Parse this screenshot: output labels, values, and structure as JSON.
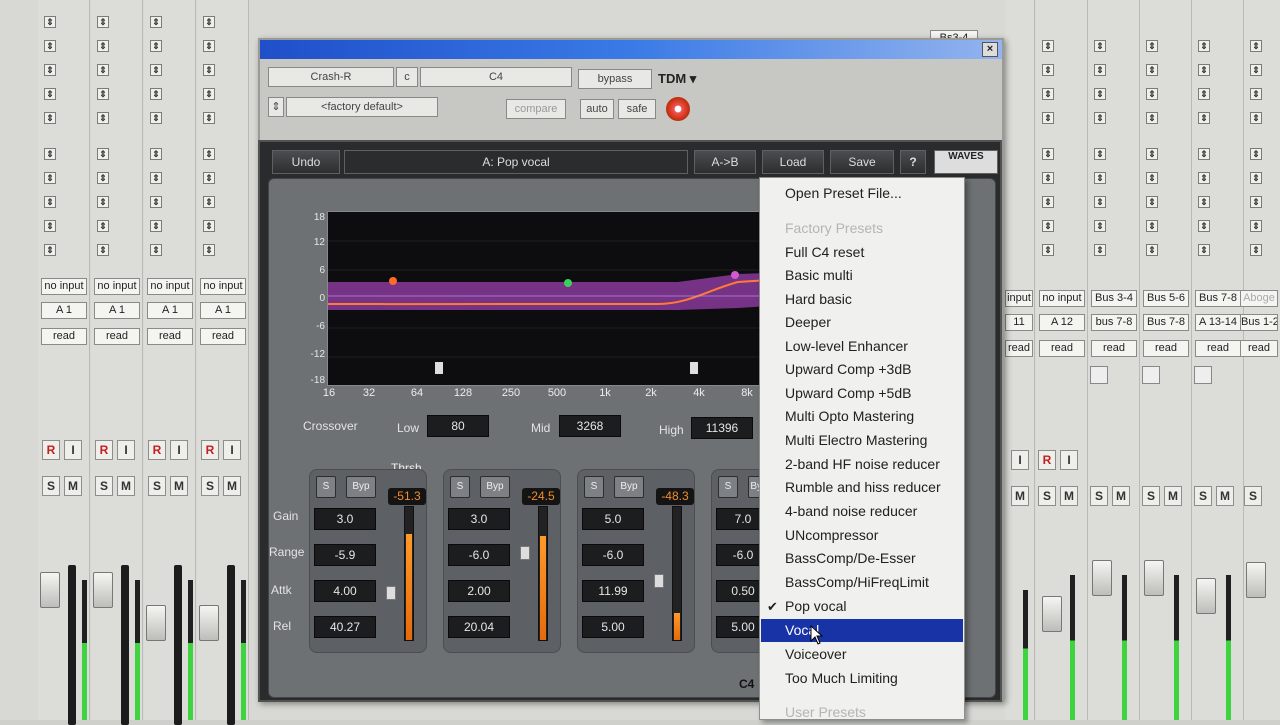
{
  "mixer": {
    "left_strips": [
      {
        "io": "no input",
        "out": "A 1",
        "mode": "read"
      },
      {
        "io": "no input",
        "out": "A 1",
        "mode": "read"
      },
      {
        "io": "no input",
        "out": "A 1",
        "mode": "read"
      },
      {
        "io": "no input",
        "out": "A 1",
        "mode": "read"
      }
    ],
    "right_strips": [
      {
        "io": "input",
        "out": "11",
        "mode": "read"
      },
      {
        "io": "no input",
        "out": "A 12",
        "mode": "read"
      },
      {
        "io": "Bus 3-4",
        "out": "bus 7-8",
        "mode": "read"
      },
      {
        "io": "Bus 5-6",
        "out": "Bus 7-8",
        "mode": "read"
      },
      {
        "io": "Bus 7-8",
        "out": "A 13-14",
        "mode": "read"
      },
      {
        "io": "Aboge",
        "out": "Bus 1-2",
        "mode": "read"
      }
    ],
    "top_insert_label": "Bs3-4",
    "rec_label": "R",
    "input_label": "I",
    "solo_label": "S",
    "mute_label": "M"
  },
  "protools_window": {
    "track": "Crash-R",
    "channel": "c",
    "plugin": "C4",
    "bypass": "bypass",
    "format": "TDM ▾",
    "preset": "<factory default>",
    "compare": "compare",
    "auto": "auto",
    "safe": "safe",
    "close": "×"
  },
  "plugin": {
    "undo": "Undo",
    "preset_name": "A: Pop vocal",
    "ab": "A->B",
    "load": "Load",
    "save": "Save",
    "help": "?",
    "logo": "WAVES",
    "name_footer": "C4",
    "graph": {
      "y_ticks": [
        "18",
        "12",
        "6",
        "0",
        "-6",
        "-12",
        "-18"
      ],
      "x_ticks": [
        "16",
        "32",
        "64",
        "128",
        "250",
        "500",
        "1k",
        "2k",
        "4k",
        "8k"
      ]
    },
    "crossover": {
      "label": "Crossover",
      "low_label": "Low",
      "low": "80",
      "mid_label": "Mid",
      "mid": "3268",
      "high_label": "High",
      "high": "11396"
    },
    "row_labels": {
      "gain": "Gain",
      "range": "Range",
      "attack": "Attk",
      "release": "Rel",
      "thresh": "Thrsh"
    },
    "solo": "S",
    "byp": "Byp",
    "bands": [
      {
        "thresh": "-51.3",
        "gain": "3.0",
        "range": "-5.9",
        "attack": "4.00",
        "release": "40.27",
        "level": 0.8
      },
      {
        "thresh": "-24.5",
        "gain": "3.0",
        "range": "-6.0",
        "attack": "2.00",
        "release": "20.04",
        "level": 0.78
      },
      {
        "thresh": "-48.3",
        "gain": "5.0",
        "range": "-6.0",
        "attack": "11.99",
        "release": "5.00",
        "level": 0.2
      },
      {
        "thresh": "",
        "gain": "7.0",
        "range": "-6.0",
        "attack": "0.50",
        "release": "5.00",
        "level": 0
      }
    ]
  },
  "preset_menu": {
    "open": "Open Preset File...",
    "factory_header": "Factory Presets",
    "items": [
      "Full C4 reset",
      "Basic multi",
      "Hard basic",
      "Deeper",
      "Low-level Enhancer",
      "Upward Comp +3dB",
      "Upward Comp +5dB",
      "Multi Opto Mastering",
      "Multi Electro Mastering",
      "2-band HF noise reducer",
      "Rumble and hiss reducer",
      "4-band noise reducer",
      "UNcompressor",
      "BassComp/De-Esser",
      "BassComp/HiFreqLimit",
      "Pop vocal",
      "Vocal",
      "Voiceover",
      "Too Much Limiting"
    ],
    "checked": "Pop vocal",
    "selected": "Vocal",
    "user_header": "User Presets"
  }
}
